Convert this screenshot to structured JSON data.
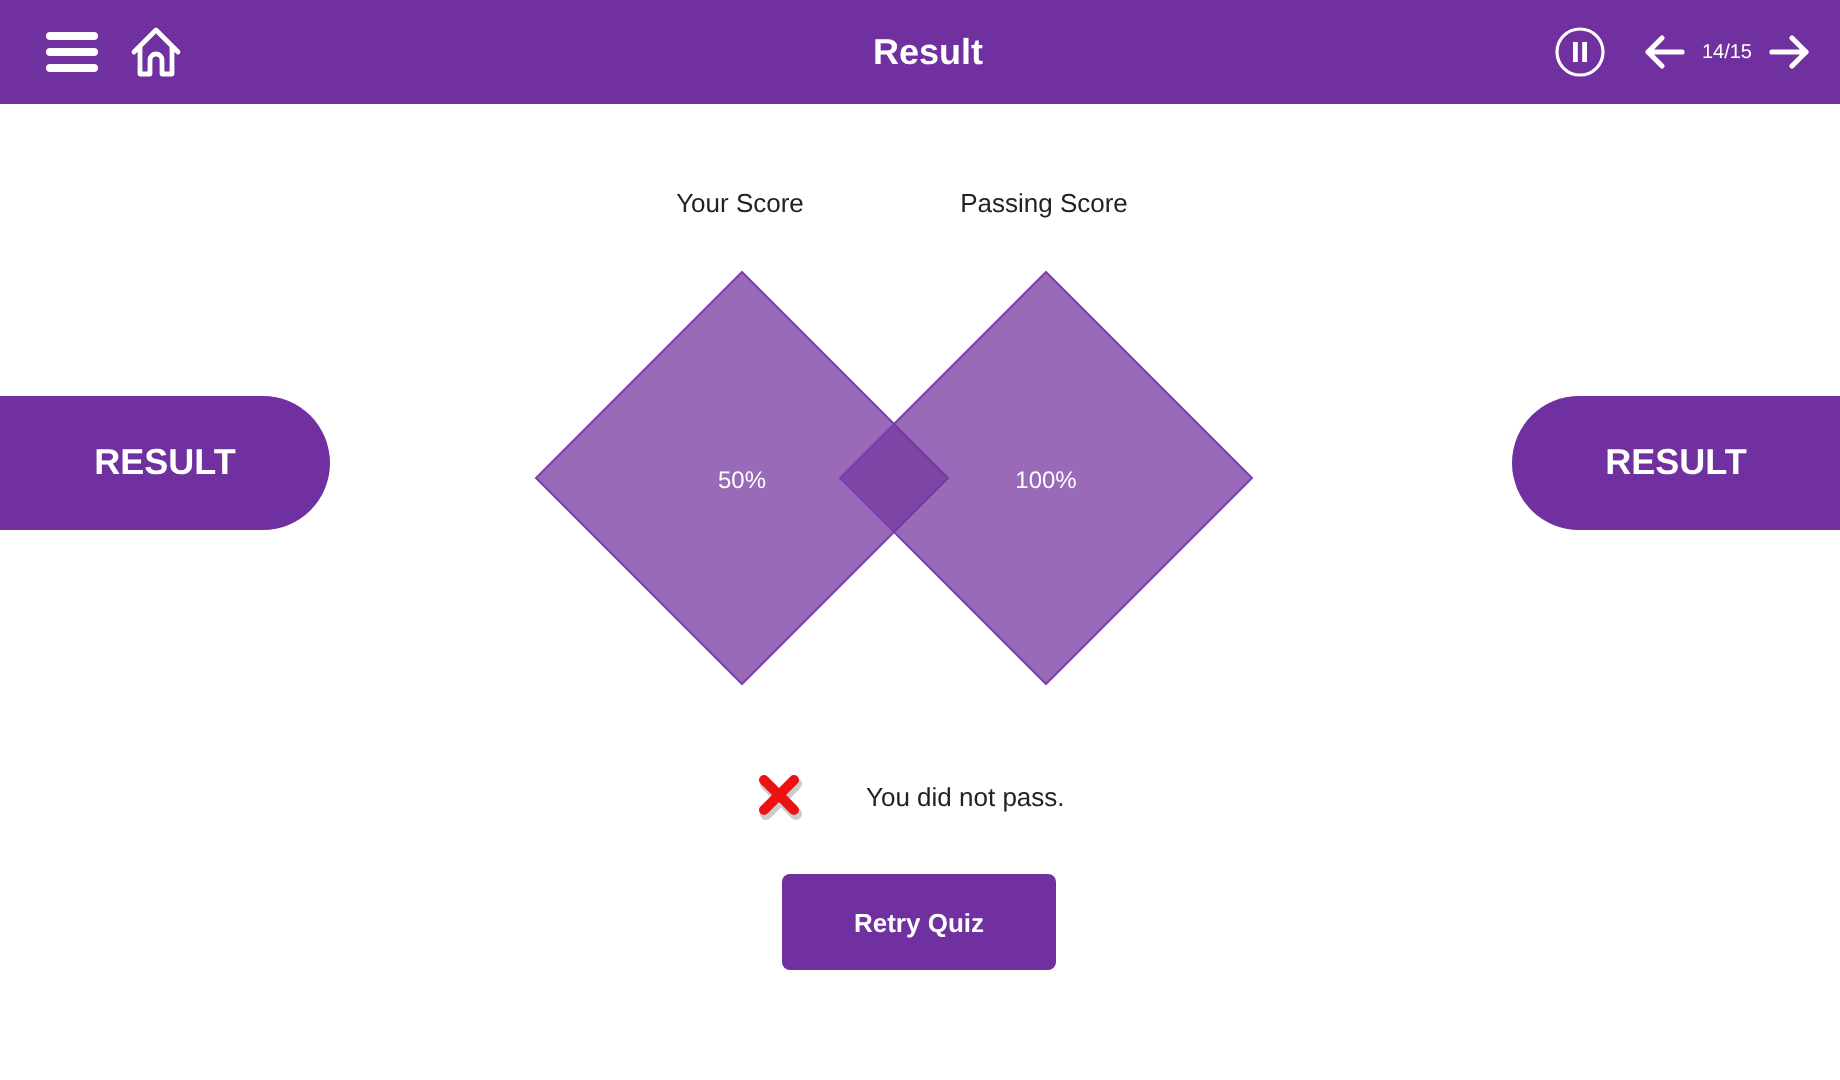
{
  "header": {
    "title": "Result",
    "page_counter": "14/15"
  },
  "side_tabs": [
    {
      "label": "RESULT"
    },
    {
      "label": "RESULT"
    }
  ],
  "scores": [
    {
      "label": "Your Score",
      "value": "50%"
    },
    {
      "label": "Passing Score",
      "value": "100%"
    }
  ],
  "outcome": {
    "passed": false,
    "message": "You did not pass."
  },
  "buttons": [
    {
      "label": "Retry Quiz"
    }
  ]
}
